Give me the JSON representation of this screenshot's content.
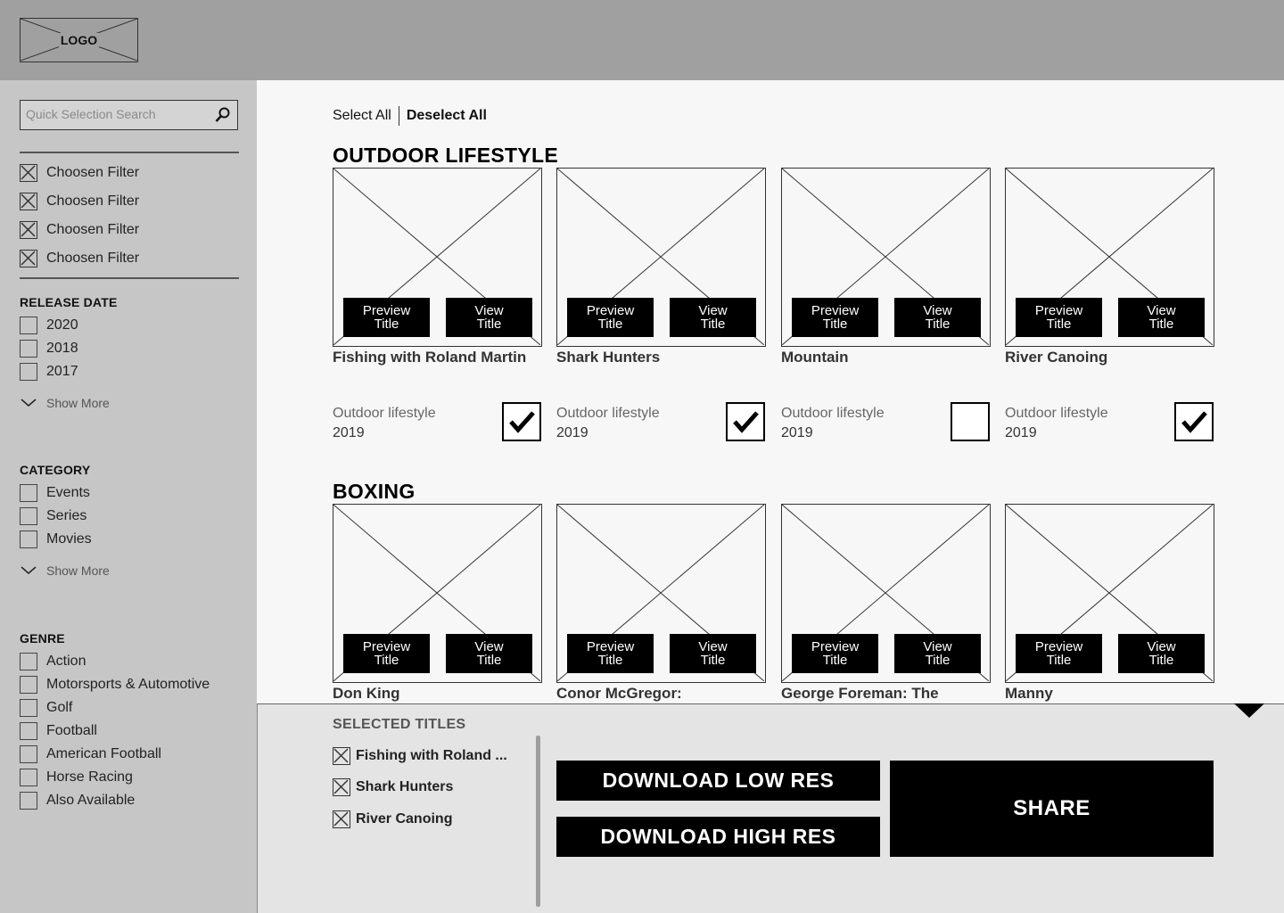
{
  "header": {
    "logo_text": "LOGO"
  },
  "sidebar": {
    "search": {
      "placeholder": "Quick Selection Search",
      "value": ""
    },
    "chosen_filters": [
      "Choosen Filter",
      "Choosen Filter",
      "Choosen Filter",
      "Choosen Filter"
    ],
    "release_date": {
      "title": "RELEASE DATE",
      "options": [
        "2020",
        "2018",
        "2017"
      ],
      "show_more": "Show More"
    },
    "category": {
      "title": "CATEGORY",
      "options": [
        "Events",
        "Series",
        "Movies"
      ],
      "show_more": "Show More"
    },
    "genre": {
      "title": "GENRE",
      "options": [
        "Action",
        "Motorsports & Automotive",
        "Golf",
        "Football",
        "American Football",
        "Horse Racing",
        "Also Available"
      ]
    }
  },
  "main": {
    "select_all": "Select All",
    "deselect_all": "Deselect All",
    "sections": [
      {
        "heading": "OUTDOOR LIFESTYLE",
        "cards": [
          {
            "title": "Fishing with Roland Martin",
            "category": "Outdoor lifestyle",
            "year": "2019",
            "checked": true
          },
          {
            "title": "Shark Hunters",
            "category": "Outdoor lifestyle",
            "year": "2019",
            "checked": true
          },
          {
            "title": "Mountain",
            "category": "Outdoor lifestyle",
            "year": "2019",
            "checked": false
          },
          {
            "title": "River Canoing",
            "category": "Outdoor lifestyle",
            "year": "2019",
            "checked": true
          }
        ]
      },
      {
        "heading": "BOXING",
        "cards": [
          {
            "title": "Don King"
          },
          {
            "title": "Conor McGregor:"
          },
          {
            "title": "George Foreman: The"
          },
          {
            "title": "Manny"
          }
        ]
      }
    ],
    "preview_label_1": "Preview",
    "preview_label_2": "Title",
    "view_label_1": "View",
    "view_label_2": "Title"
  },
  "panel": {
    "heading": "SELECTED TITLES",
    "selected": [
      "Fishing with Roland ...",
      "Shark Hunters",
      "River Canoing"
    ],
    "download_low": "DOWNLOAD LOW RES",
    "download_high": "DOWNLOAD HIGH RES",
    "share": "SHARE"
  },
  "icons": {
    "search": "search-icon",
    "remove": "x-box-icon",
    "chevron": "chevron-down-icon",
    "check": "checkmark-icon",
    "placeholder": "image-placeholder-icon",
    "collapse": "caret-down-icon"
  }
}
